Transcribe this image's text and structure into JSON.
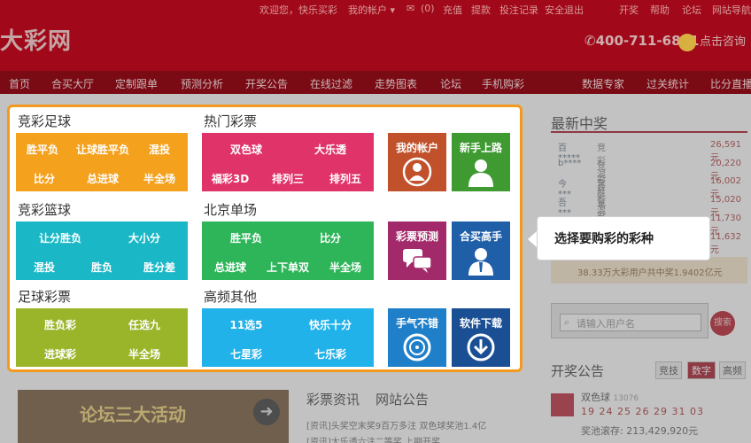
{
  "header": {
    "toplinks": [
      "欢迎您，快乐买彩",
      "我的帐户 ▾",
      "(0)",
      "充值",
      "提款",
      "投注记录",
      "安全退出",
      "开奖",
      "帮助",
      "论坛",
      "网站导航"
    ],
    "logo": "大彩网",
    "phone": "400-711-6891",
    "consult": "点击咨询"
  },
  "nav": [
    "首页",
    "合买大厅",
    "定制跟单",
    "预测分析",
    "开奖公告",
    "在线过滤",
    "走势图表",
    "论坛",
    "手机购彩",
    "数据专家",
    "过关统计",
    "比分直播"
  ],
  "panel": {
    "sections": {
      "jczq": "竞彩足球",
      "rmcp": "热门彩票",
      "jclq": "竞彩篮球",
      "bjdc": "北京单场",
      "zqcp": "足球彩票",
      "gpqt": "高频其他"
    },
    "tiles": {
      "jczq": [
        "胜平负",
        "让球胜平负",
        "混投",
        "比分",
        "总进球",
        "半全场"
      ],
      "rmcp": [
        "双色球",
        "大乐透",
        "福彩3D",
        "排列三",
        "排列五"
      ],
      "jclq": [
        "让分胜负",
        "大小分",
        "混投",
        "胜负",
        "胜分差"
      ],
      "bjdc": [
        "胜平负",
        "比分",
        "总进球",
        "上下单双",
        "半全场"
      ],
      "zqcp": [
        "胜负彩",
        "任选九",
        "进球彩",
        "半全场"
      ],
      "gpqt": [
        "11选5",
        "快乐十分",
        "七星彩",
        "七乐彩"
      ]
    },
    "squares": [
      "我的帐户",
      "新手上路",
      "彩票预测",
      "合买高手",
      "手气不错",
      "软件下载"
    ]
  },
  "callout": "选择要购彩的彩种",
  "sidebar": {
    "title": "最新中奖",
    "winners": [
      {
        "name": "百*****",
        "type": "竞彩混合",
        "amount": "26,591元"
      },
      {
        "name": "b****",
        "type": "竞彩胜平负",
        "amount": "20,220元"
      },
      {
        "name": "今***",
        "type": "竞彩混合",
        "amount": "16,002元"
      },
      {
        "name": "吾***",
        "type": "竞彩混合",
        "amount": "15,020元"
      },
      {
        "name": "",
        "type": "",
        "amount": "11,730元"
      },
      {
        "name": "",
        "type": "",
        "amount": "11,632元"
      }
    ],
    "banner": "38.33万大彩用户共中奖1.9402亿元",
    "search_placeholder": "请输入用户名",
    "search_button": "搜索",
    "kj_title": "开奖公告",
    "kj_tabs": [
      "竞技",
      "数字",
      "高频"
    ],
    "lotto_name": "双色球",
    "lotto_issue": "13076",
    "lotto_nums": "19 24 25 26 29 31 03",
    "lotto_pool": "奖池滚存: 213,429,920元"
  },
  "bottom": {
    "forum_banner": "论坛三大活动",
    "news_tabs": [
      "彩票资讯",
      "网站公告"
    ],
    "news": [
      "[资讯]头奖空末奖9百万多注 双色球奖池1.4亿",
      "[资讯]大乐透六注二等奖 上期开奖..."
    ]
  },
  "colors": {
    "header": "#a1091a",
    "orange": "#f4a11e",
    "pink": "#e0336a",
    "teal": "#1ab8c6",
    "green": "#2eb55a",
    "olive": "#9bb52a",
    "sky": "#22b2ea",
    "rust": "#c0512a",
    "darkgreen": "#3f9a32",
    "magenta": "#a32a6a",
    "navy": "#1f5fa8",
    "highlight_border": "#f39a1e"
  }
}
